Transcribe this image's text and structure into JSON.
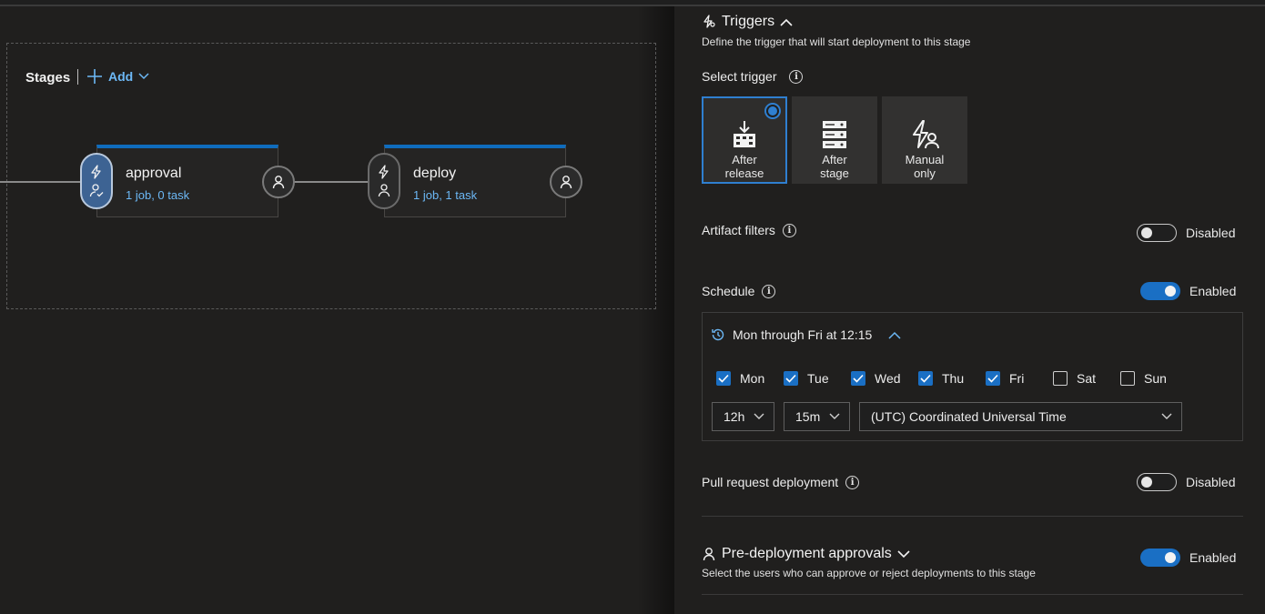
{
  "canvas": {
    "stages_title": "Stages",
    "add_label": "Add",
    "stages": [
      {
        "name": "approval",
        "summary": "1 job, 0 task"
      },
      {
        "name": "deploy",
        "summary": "1 job, 1 task"
      }
    ]
  },
  "triggers": {
    "title": "Triggers",
    "description": "Define the trigger that will start deployment to this stage",
    "select_label": "Select trigger",
    "options": [
      {
        "line1": "After",
        "line2": "release"
      },
      {
        "line1": "After",
        "line2": "stage"
      },
      {
        "line1": "Manual",
        "line2": "only"
      }
    ],
    "selected_option": "After release"
  },
  "artifact_filters": {
    "label": "Artifact filters",
    "state": "Disabled"
  },
  "schedule": {
    "label": "Schedule",
    "state": "Enabled",
    "summary": "Mon through Fri at 12:15",
    "days": [
      {
        "label": "Mon",
        "checked": true
      },
      {
        "label": "Tue",
        "checked": true
      },
      {
        "label": "Wed",
        "checked": true
      },
      {
        "label": "Thu",
        "checked": true
      },
      {
        "label": "Fri",
        "checked": true
      },
      {
        "label": "Sat",
        "checked": false
      },
      {
        "label": "Sun",
        "checked": false
      }
    ],
    "hour": "12h",
    "minute": "15m",
    "timezone": "(UTC) Coordinated Universal Time"
  },
  "pull_request": {
    "label": "Pull request deployment",
    "state": "Disabled"
  },
  "approvals": {
    "title": "Pre-deployment approvals",
    "description": "Select the users who can approve or reject deployments to this stage",
    "state": "Enabled"
  },
  "colors": {
    "accent": "#0f6cbd",
    "link": "#6cb8f6",
    "background": "#1f1f1f"
  }
}
